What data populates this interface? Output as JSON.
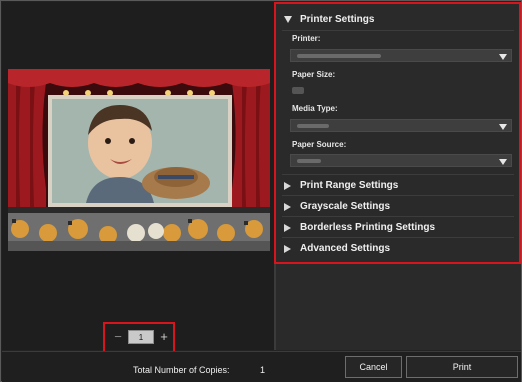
{
  "copies": {
    "value": "1",
    "minus_symbol": "−",
    "plus_symbol": "+"
  },
  "settings": {
    "printer_settings": {
      "title": "Printer Settings",
      "printer_label": "Printer:",
      "paper_size_label": "Paper Size:",
      "media_type_label": "Media Type:",
      "paper_source_label": "Paper Source:"
    },
    "collapsed_sections": [
      {
        "title": "Print Range Settings"
      },
      {
        "title": "Grayscale Settings"
      },
      {
        "title": "Borderless Printing Settings"
      },
      {
        "title": "Advanced Settings"
      }
    ]
  },
  "footer": {
    "total_copies_label": "Total Number of Copies:",
    "total_copies_value": "1",
    "cancel_label": "Cancel",
    "print_label": "Print"
  },
  "colors": {
    "highlight": "#d8141c",
    "background": "#232323"
  }
}
